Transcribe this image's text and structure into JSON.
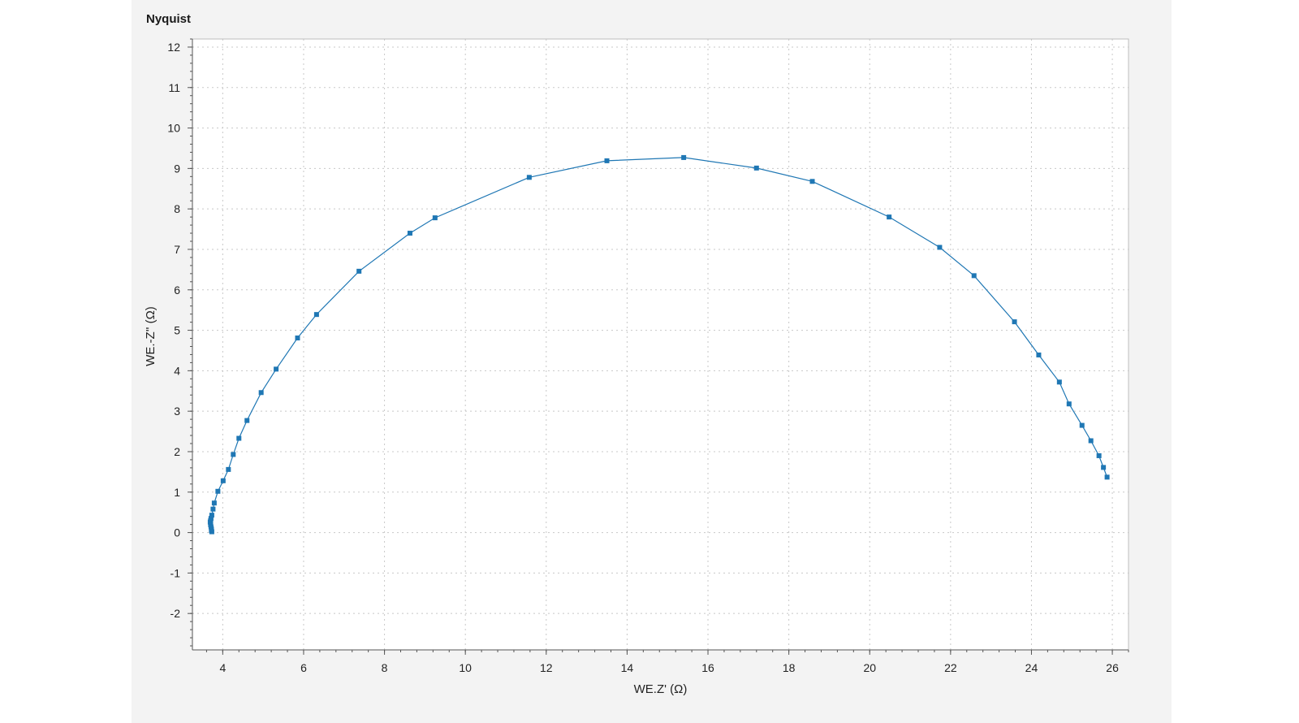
{
  "chart_data": {
    "type": "scatter",
    "title": "Nyquist",
    "xlabel": "WE.Z' (Ω)",
    "ylabel": "WE.-Z'' (Ω)",
    "xlim": [
      3.25,
      26.4
    ],
    "ylim": [
      -2.9,
      12.2
    ],
    "xticks": [
      4,
      6,
      8,
      10,
      12,
      14,
      16,
      18,
      20,
      22,
      24,
      26
    ],
    "yticks": [
      -2,
      -1,
      0,
      1,
      2,
      3,
      4,
      5,
      6,
      7,
      8,
      9,
      10,
      11,
      12
    ],
    "grid": true,
    "line_connected": true,
    "series_color": "#1f77b4",
    "x": [
      3.73,
      3.72,
      3.72,
      3.71,
      3.7,
      3.7,
      3.69,
      3.7,
      3.71,
      3.73,
      3.76,
      3.79,
      3.88,
      4.01,
      4.14,
      4.26,
      4.4,
      4.6,
      4.95,
      5.32,
      5.85,
      6.32,
      7.37,
      8.63,
      9.25,
      11.58,
      13.5,
      15.4,
      17.2,
      18.58,
      20.48,
      21.73,
      22.58,
      23.58,
      24.18,
      24.69,
      24.93,
      25.25,
      25.47,
      25.67,
      25.78,
      25.87
    ],
    "y": [
      0.02,
      0.05,
      0.09,
      0.14,
      0.19,
      0.23,
      0.26,
      0.3,
      0.35,
      0.43,
      0.58,
      0.73,
      1.02,
      1.28,
      1.56,
      1.93,
      2.33,
      2.77,
      3.46,
      4.04,
      4.81,
      5.39,
      6.46,
      7.4,
      7.78,
      8.78,
      9.19,
      9.27,
      9.01,
      8.68,
      7.8,
      7.05,
      6.35,
      5.21,
      4.39,
      3.72,
      3.18,
      2.65,
      2.27,
      1.9,
      1.61,
      1.37
    ]
  }
}
